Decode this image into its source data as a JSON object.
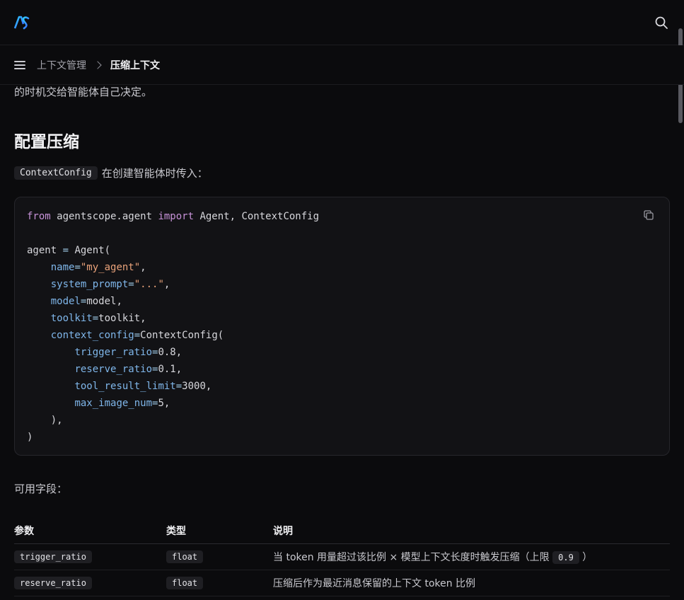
{
  "header": {
    "logo_text": "AS",
    "search_icon": "search-icon"
  },
  "breadcrumb": {
    "parent": "上下文管理",
    "current": "压缩上下文"
  },
  "intro_text": "的时机交给智能体自己决定。",
  "section_heading": "配置压缩",
  "config_para": {
    "code": "ContextConfig",
    "text": "在创建智能体时传入："
  },
  "code_lines": [
    "from agentscope.agent import Agent, ContextConfig",
    "",
    "agent = Agent(",
    "    name=\"my_agent\",",
    "    system_prompt=\"...\",",
    "    model=model,",
    "    toolkit=toolkit,",
    "    context_config=ContextConfig(",
    "        trigger_ratio=0.8,",
    "        reserve_ratio=0.1,",
    "        tool_result_limit=3000,",
    "        max_image_num=5,",
    "    ),",
    ")"
  ],
  "fields_label": "可用字段：",
  "table": {
    "headers": [
      "参数",
      "类型",
      "说明"
    ],
    "rows": [
      {
        "param": "trigger_ratio",
        "type": "float",
        "desc": "当 token 用量超过该比例 × 模型上下文长度时触发压缩（上限",
        "desc_code": "0.9",
        "desc_tail": "）"
      },
      {
        "param": "reserve_ratio",
        "type": "float",
        "desc": "压缩后作为最近消息保留的上下文 token 比例"
      }
    ]
  },
  "colors": {
    "background": "#0b0b0d",
    "code_bg": "#121215",
    "keyword": "#c792d8",
    "string": "#e9a27a",
    "argument": "#7fb6ea"
  }
}
